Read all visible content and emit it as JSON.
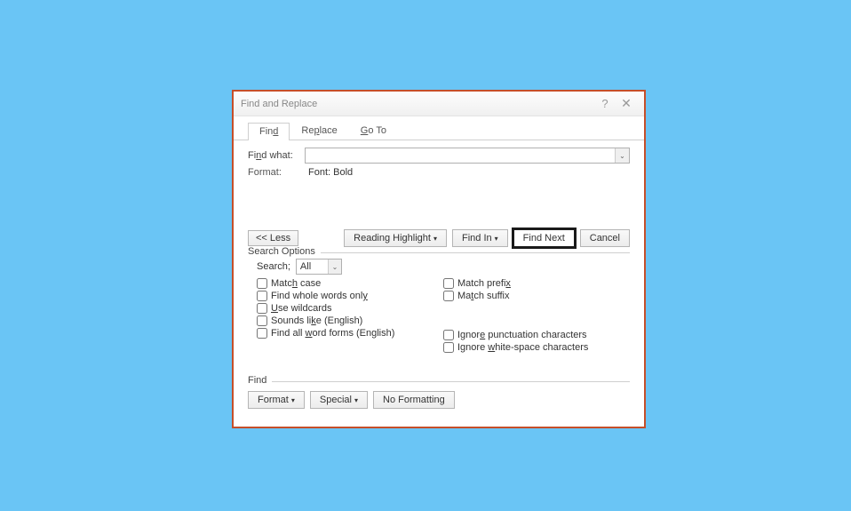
{
  "dialog": {
    "title": "Find and Replace",
    "help": "?",
    "close": "✕"
  },
  "tabs": {
    "find": "Find",
    "replace": "Replace",
    "goto": "Go To"
  },
  "find": {
    "label": "Find what:",
    "value": "",
    "format_label": "Format:",
    "format_value": "Font: Bold"
  },
  "buttons": {
    "less": "<< Less",
    "reading_highlight": "Reading Highlight",
    "find_in": "Find In",
    "find_next": "Find Next",
    "cancel": "Cancel"
  },
  "search_options": {
    "legend": "Search Options",
    "search_label": "Search;",
    "search_value": "All",
    "match_case": "Match case",
    "whole_words": "Find whole words only",
    "wildcards": "Use wildcards",
    "sounds_like": "Sounds like (English)",
    "word_forms": "Find all word forms (English)",
    "match_prefix": "Match prefix",
    "match_suffix": "Match suffix",
    "ignore_punct": "Ignore punctuation characters",
    "ignore_ws": "Ignore white-space characters"
  },
  "bottom": {
    "legend": "Find",
    "format": "Format",
    "special": "Special",
    "no_formatting": "No Formatting"
  }
}
